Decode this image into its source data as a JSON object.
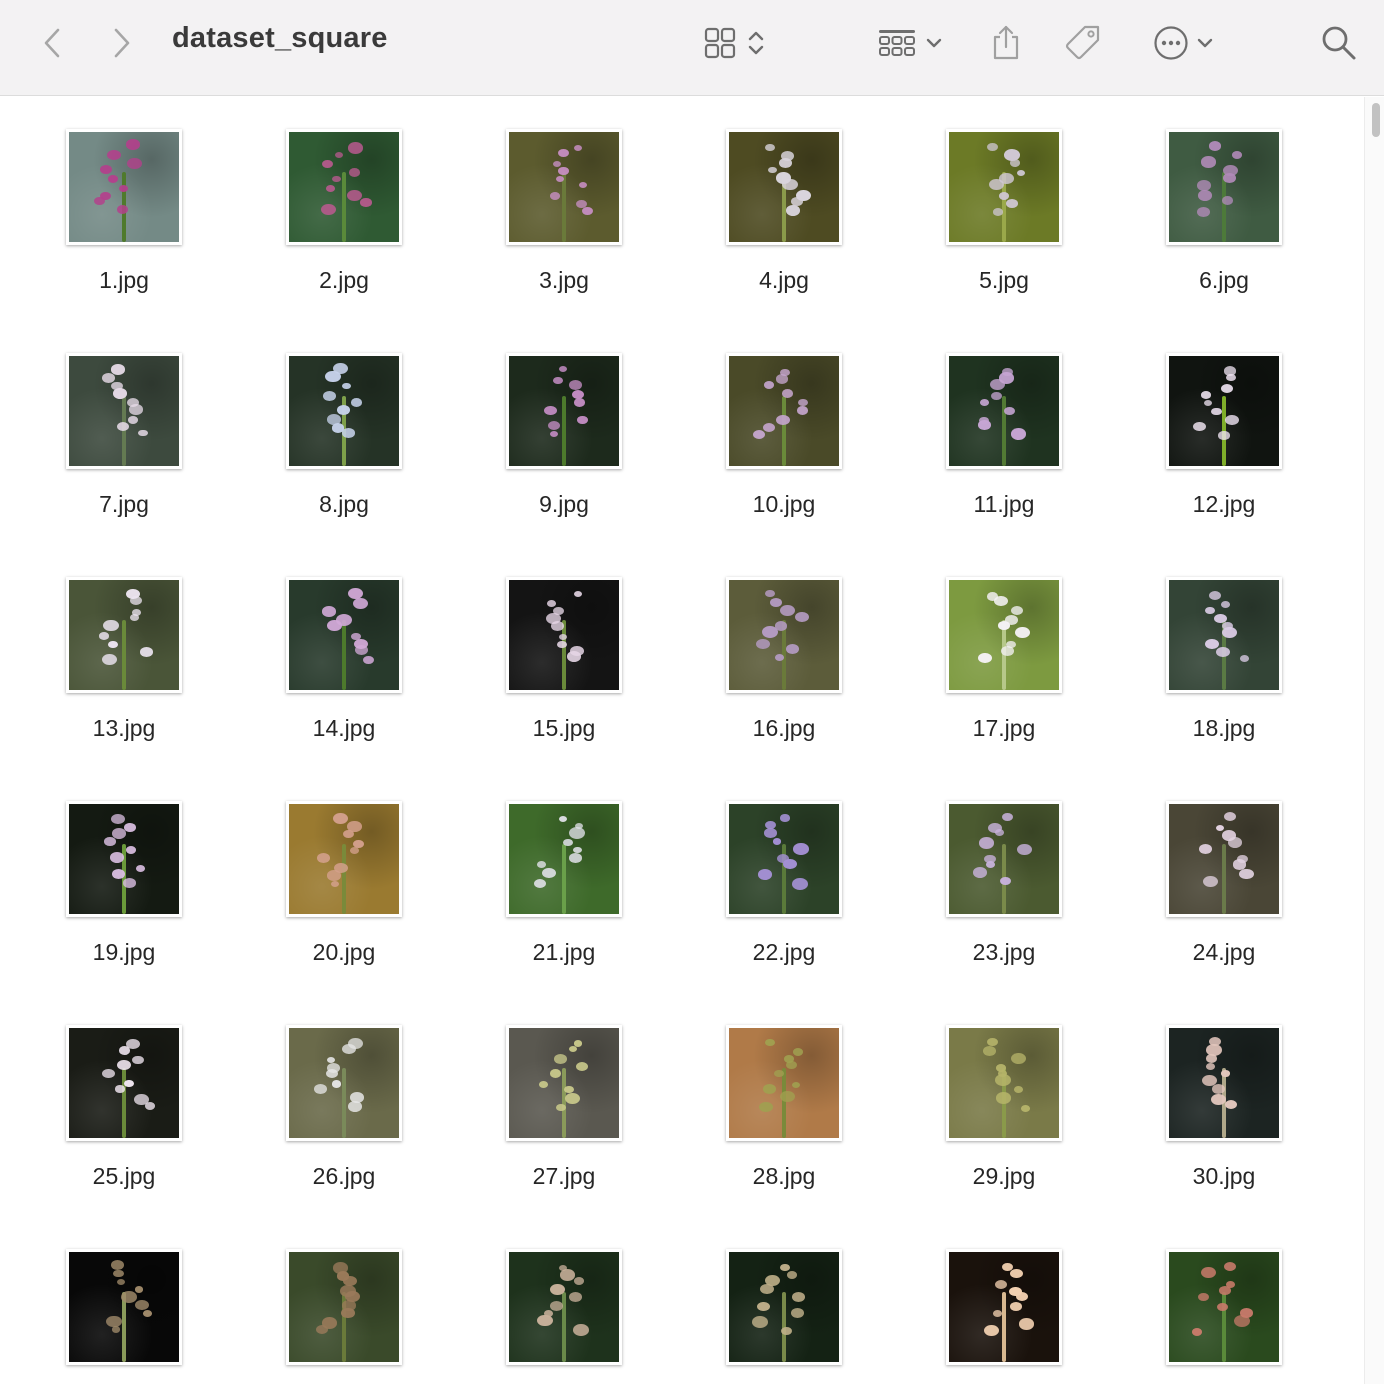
{
  "window": {
    "title": "dataset_square"
  },
  "toolbar": {
    "back_icon": "chevron-left-icon",
    "forward_icon": "chevron-right-icon",
    "view_icon": "icon-grid-view-icon",
    "group_icon": "group-by-icon",
    "share_icon": "share-icon",
    "tag_icon": "tag-icon",
    "more_icon": "ellipsis-circle-icon",
    "search_icon": "search-icon"
  },
  "files": [
    {
      "name": "1.jpg",
      "bg": "#748a86",
      "accent": "#b43f8c",
      "stem": "#4f7a2c"
    },
    {
      "name": "2.jpg",
      "bg": "#2f5a33",
      "accent": "#b85a8e",
      "stem": "#5a8a3a"
    },
    {
      "name": "3.jpg",
      "bg": "#5c5b2e",
      "accent": "#c98fc5",
      "stem": "#6a7a3a"
    },
    {
      "name": "4.jpg",
      "bg": "#4e4b22",
      "accent": "#d9d4dc",
      "stem": "#8a9a4a"
    },
    {
      "name": "5.jpg",
      "bg": "#6c7a26",
      "accent": "#cfc7d3",
      "stem": "#9aa84a"
    },
    {
      "name": "6.jpg",
      "bg": "#3f5b42",
      "accent": "#b08ab8",
      "stem": "#4d7a3a"
    },
    {
      "name": "7.jpg",
      "bg": "#3d4a3e",
      "accent": "#e7dbe8",
      "stem": "#647a52"
    },
    {
      "name": "8.jpg",
      "bg": "#253326",
      "accent": "#c6d2ea",
      "stem": "#7ea04a"
    },
    {
      "name": "9.jpg",
      "bg": "#1d2a1c",
      "accent": "#c18bc1",
      "stem": "#4d7a2c"
    },
    {
      "name": "10.jpg",
      "bg": "#4a4a28",
      "accent": "#c5a5cd",
      "stem": "#6a8a3a"
    },
    {
      "name": "11.jpg",
      "bg": "#1f3320",
      "accent": "#c6a5d3",
      "stem": "#527a34"
    },
    {
      "name": "12.jpg",
      "bg": "#101410",
      "accent": "#efe4f2",
      "stem": "#7fae2a"
    },
    {
      "name": "13.jpg",
      "bg": "#4a5538",
      "accent": "#ece4f0",
      "stem": "#6a8a3a"
    },
    {
      "name": "14.jpg",
      "bg": "#283a2c",
      "accent": "#d2a9d8",
      "stem": "#4d7a2c"
    },
    {
      "name": "15.jpg",
      "bg": "#141414",
      "accent": "#e6d6e6",
      "stem": "#6a8a3a"
    },
    {
      "name": "16.jpg",
      "bg": "#5c5c3a",
      "accent": "#b39ac0",
      "stem": "#6a7a3a"
    },
    {
      "name": "17.jpg",
      "bg": "#7d9a40",
      "accent": "#f4f1f4",
      "stem": "#b6c88a"
    },
    {
      "name": "18.jpg",
      "bg": "#334436",
      "accent": "#dbcce6",
      "stem": "#5a7a44"
    },
    {
      "name": "19.jpg",
      "bg": "#141a12",
      "accent": "#d8bde0",
      "stem": "#6a9a3a"
    },
    {
      "name": "20.jpg",
      "bg": "#9a7a30",
      "accent": "#d4a08c",
      "stem": "#7a8a3a"
    },
    {
      "name": "21.jpg",
      "bg": "#3e6a2a",
      "accent": "#e2e2ea",
      "stem": "#6aa04a"
    },
    {
      "name": "22.jpg",
      "bg": "#2c4228",
      "accent": "#a390d3",
      "stem": "#5a7a3a"
    },
    {
      "name": "23.jpg",
      "bg": "#4b5a30",
      "accent": "#c8b2dc",
      "stem": "#7a8a4a"
    },
    {
      "name": "24.jpg",
      "bg": "#4a4636",
      "accent": "#e4d3e2",
      "stem": "#6a7a4a"
    },
    {
      "name": "25.jpg",
      "bg": "#1a1c16",
      "accent": "#f0e6f0",
      "stem": "#6a8a3a"
    },
    {
      "name": "26.jpg",
      "bg": "#6a6a4a",
      "accent": "#e6e6e6",
      "stem": "#7a8a5a"
    },
    {
      "name": "27.jpg",
      "bg": "#5a5850",
      "accent": "#c8c88a",
      "stem": "#8a9a5a"
    },
    {
      "name": "28.jpg",
      "bg": "#b07a48",
      "accent": "#a0a050",
      "stem": "#7a8a3a"
    },
    {
      "name": "29.jpg",
      "bg": "#7a7a48",
      "accent": "#b6b46a",
      "stem": "#8a9a4a"
    },
    {
      "name": "30.jpg",
      "bg": "#1c2422",
      "accent": "#e2c6bc",
      "stem": "#b0a88a"
    },
    {
      "name": "",
      "bg": "#080808",
      "accent": "#a08a6a",
      "stem": "#8a9a5a"
    },
    {
      "name": "",
      "bg": "#3a4a2a",
      "accent": "#9a7a5a",
      "stem": "#6a7a3a"
    },
    {
      "name": "",
      "bg": "#1e321c",
      "accent": "#c8b09a",
      "stem": "#6a8a4a"
    },
    {
      "name": "",
      "bg": "#142214",
      "accent": "#c0b08a",
      "stem": "#7a8a4a"
    },
    {
      "name": "",
      "bg": "#1a120c",
      "accent": "#f2d0b0",
      "stem": "#d8b890"
    },
    {
      "name": "",
      "bg": "#2a4a1e",
      "accent": "#c87a6a",
      "stem": "#5a8a3a"
    }
  ]
}
